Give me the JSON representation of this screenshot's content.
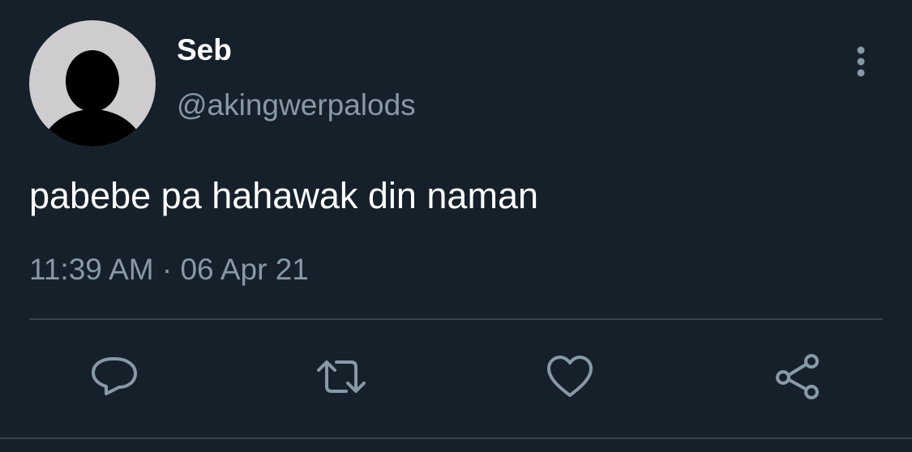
{
  "tweet": {
    "display_name": "Seb",
    "handle": "@akingwerpalods",
    "text": "pabebe pa hahawak din naman",
    "timestamp": "11:39 AM · 06 Apr 21"
  },
  "icons": {
    "avatar": "default-profile-silhouette",
    "more": "vertical-ellipsis-icon",
    "reply": "speech-bubble-icon",
    "retweet": "retweet-arrows-icon",
    "like": "heart-outline-icon",
    "share": "share-nodes-icon"
  },
  "colors": {
    "background": "#15202b",
    "primary_text": "#ffffff",
    "secondary_text": "#8899a6",
    "divider": "#38444d"
  }
}
